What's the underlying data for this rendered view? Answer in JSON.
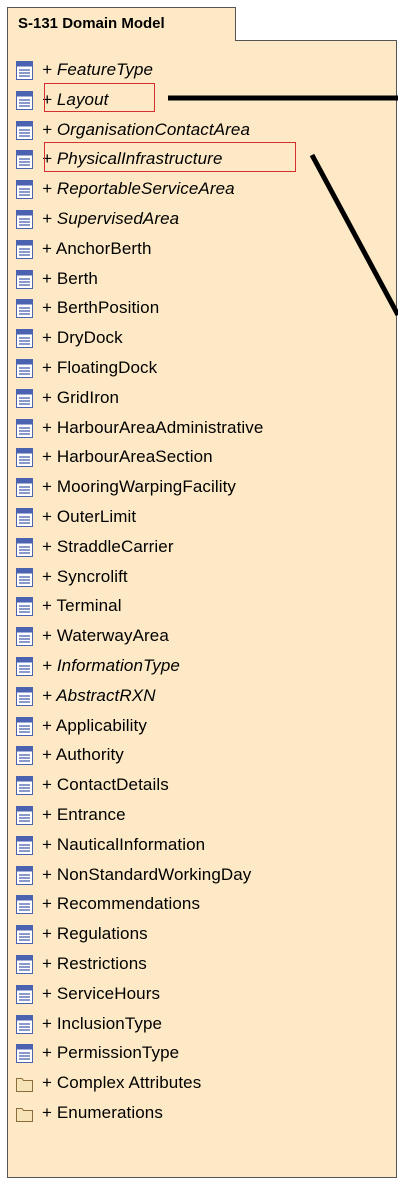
{
  "package": {
    "title": "S-131 Domain Model"
  },
  "items": [
    {
      "label": "+ FeatureType",
      "italic": true,
      "icon": "class-icon"
    },
    {
      "label": "+ Layout",
      "italic": true,
      "icon": "class-icon"
    },
    {
      "label": "+ OrganisationContactArea",
      "italic": true,
      "icon": "class-icon"
    },
    {
      "label": "+ PhysicalInfrastructure",
      "italic": true,
      "icon": "class-icon"
    },
    {
      "label": "+ ReportableServiceArea",
      "italic": true,
      "icon": "class-icon"
    },
    {
      "label": "+ SupervisedArea",
      "italic": true,
      "icon": "class-icon"
    },
    {
      "label": "+ AnchorBerth",
      "italic": false,
      "icon": "class-icon"
    },
    {
      "label": "+ Berth",
      "italic": false,
      "icon": "class-icon"
    },
    {
      "label": "+ BerthPosition",
      "italic": false,
      "icon": "class-icon"
    },
    {
      "label": "+ DryDock",
      "italic": false,
      "icon": "class-icon"
    },
    {
      "label": "+ FloatingDock",
      "italic": false,
      "icon": "class-icon"
    },
    {
      "label": "+ GridIron",
      "italic": false,
      "icon": "class-icon"
    },
    {
      "label": "+ HarbourAreaAdministrative",
      "italic": false,
      "icon": "class-icon"
    },
    {
      "label": "+ HarbourAreaSection",
      "italic": false,
      "icon": "class-icon"
    },
    {
      "label": "+ MooringWarpingFacility",
      "italic": false,
      "icon": "class-icon"
    },
    {
      "label": "+ OuterLimit",
      "italic": false,
      "icon": "class-icon"
    },
    {
      "label": "+ StraddleCarrier",
      "italic": false,
      "icon": "class-icon"
    },
    {
      "label": "+ Syncrolift",
      "italic": false,
      "icon": "class-icon"
    },
    {
      "label": "+ Terminal",
      "italic": false,
      "icon": "class-icon"
    },
    {
      "label": "+ WaterwayArea",
      "italic": false,
      "icon": "class-icon"
    },
    {
      "label": "+ InformationType",
      "italic": true,
      "icon": "class-icon"
    },
    {
      "label": "+ AbstractRXN",
      "italic": true,
      "icon": "class-icon"
    },
    {
      "label": "+ Applicability",
      "italic": false,
      "icon": "class-icon"
    },
    {
      "label": "+ Authority",
      "italic": false,
      "icon": "class-icon"
    },
    {
      "label": "+ ContactDetails",
      "italic": false,
      "icon": "class-icon"
    },
    {
      "label": "+ Entrance",
      "italic": false,
      "icon": "class-icon"
    },
    {
      "label": "+ NauticalInformation",
      "italic": false,
      "icon": "class-icon"
    },
    {
      "label": "+ NonStandardWorkingDay",
      "italic": false,
      "icon": "class-icon"
    },
    {
      "label": "+ Recommendations",
      "italic": false,
      "icon": "class-icon"
    },
    {
      "label": "+ Regulations",
      "italic": false,
      "icon": "class-icon"
    },
    {
      "label": "+ Restrictions",
      "italic": false,
      "icon": "class-icon"
    },
    {
      "label": "+ ServiceHours",
      "italic": false,
      "icon": "class-icon"
    },
    {
      "label": "+ InclusionType",
      "italic": false,
      "icon": "class-icon"
    },
    {
      "label": "+ PermissionType",
      "italic": false,
      "icon": "class-icon"
    },
    {
      "label": "+ Complex Attributes",
      "italic": false,
      "icon": "folder-icon"
    },
    {
      "label": "+ Enumerations",
      "italic": false,
      "icon": "folder-icon"
    }
  ],
  "highlighted": [
    "+ Layout",
    "+ PhysicalInfrastructure"
  ],
  "colors": {
    "package_fill": "#fde9c5",
    "highlight": "#d32f2f",
    "icon_blue": "#4a62b0",
    "folder_fill": "#f7e3b8"
  }
}
